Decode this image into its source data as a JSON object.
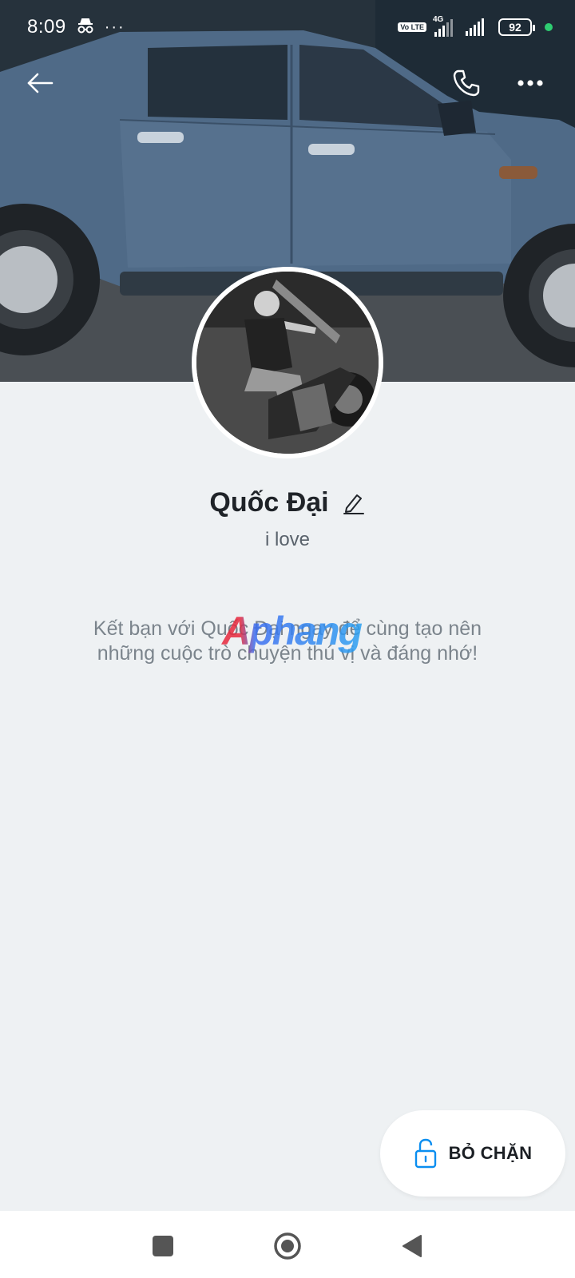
{
  "status_bar": {
    "time": "8:09",
    "network_badge": "Vo LTE",
    "network_type": "4G",
    "battery": "92",
    "icons": [
      "incognito-icon",
      "more-notifications-icon",
      "signal-icon",
      "wifi-signal-icon",
      "battery-icon"
    ]
  },
  "profile": {
    "name": "Quốc Đại",
    "status": "i love",
    "hint": "Kết bạn với Quốc Đại ngay để cùng tạo nên những cuộc trò chuyện thú vị và đáng nhớ!",
    "watermark": "Aphang"
  },
  "actions": {
    "unblock_label": "BỎ CHẶN"
  },
  "colors": {
    "background": "#eef1f3",
    "accent": "#0a8ef0",
    "text": "#1f2328"
  }
}
